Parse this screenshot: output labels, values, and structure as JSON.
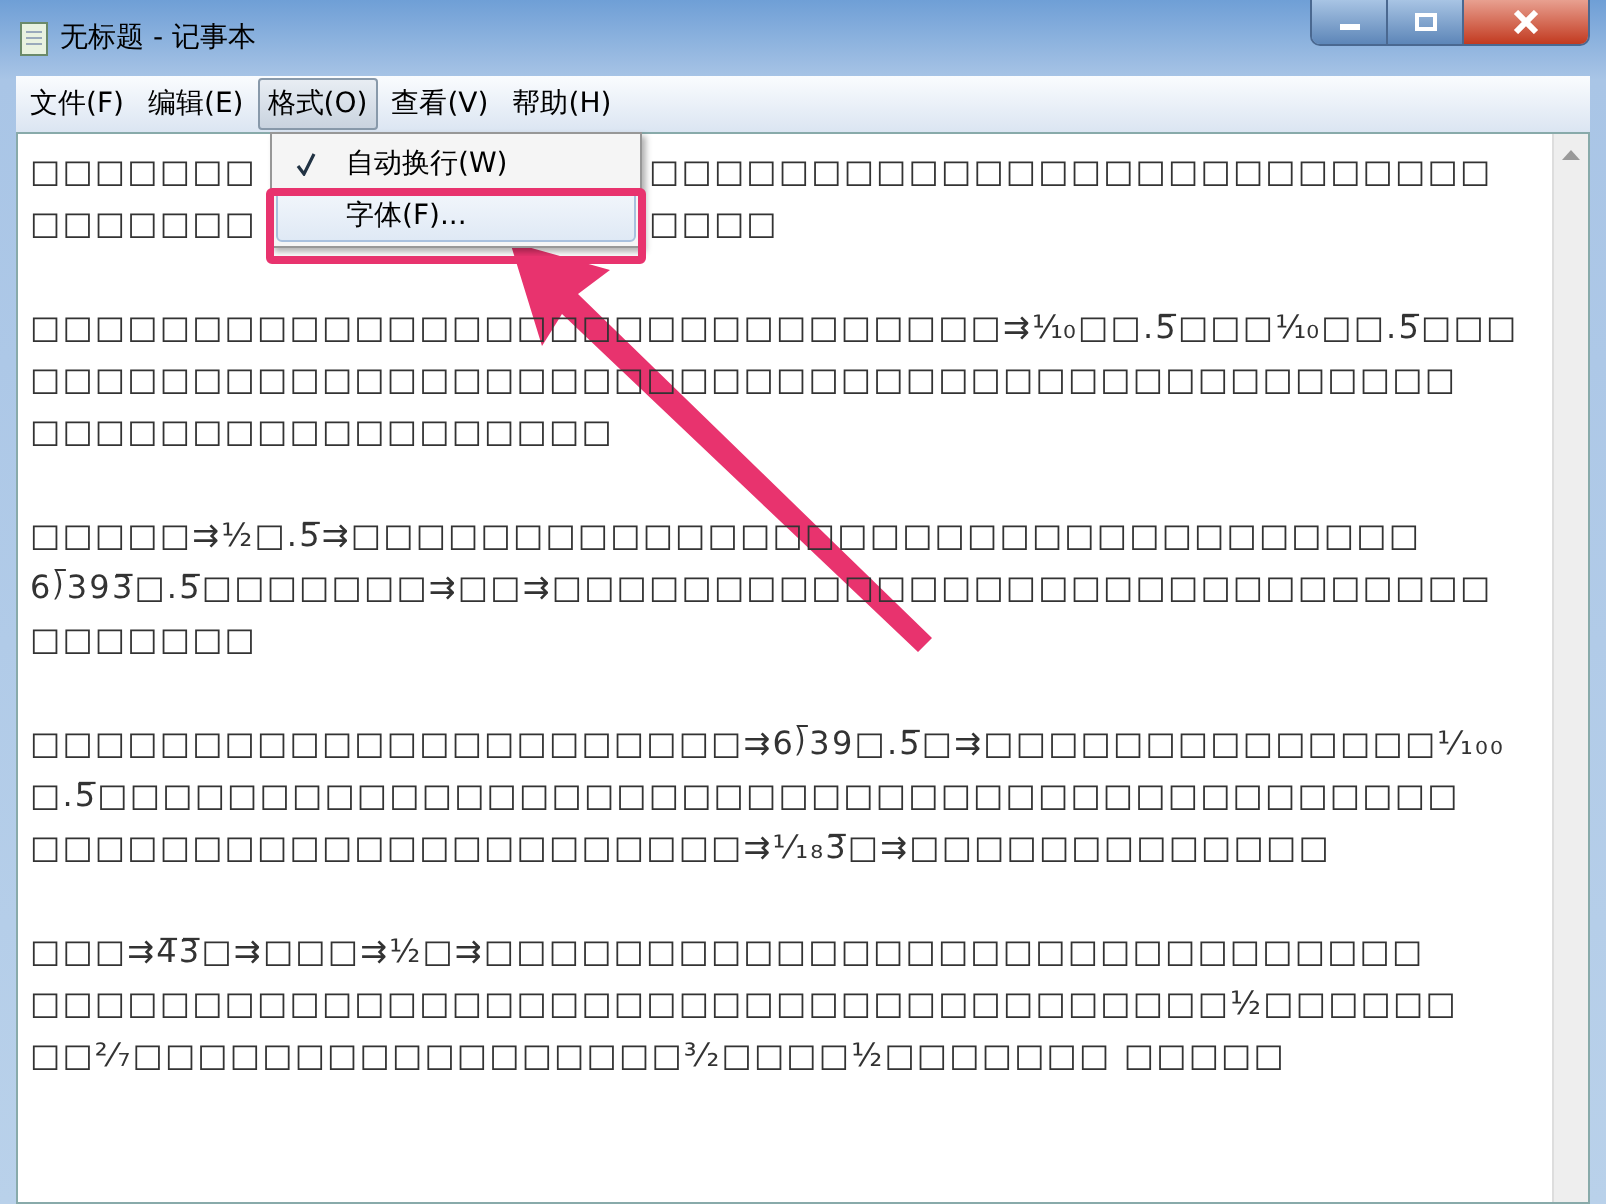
{
  "window": {
    "title": "无标题 - 记事本"
  },
  "menu_bar": [
    {
      "label": "文件(F)",
      "selected": false
    },
    {
      "label": "编辑(E)",
      "selected": false
    },
    {
      "label": "格式(O)",
      "selected": true
    },
    {
      "label": "查看(V)",
      "selected": false
    },
    {
      "label": "帮助(H)",
      "selected": false
    }
  ],
  "dropdown": [
    {
      "label": "自动换行(W)",
      "checked": true,
      "highlighted": false
    },
    {
      "label": "字体(F)...",
      "checked": false,
      "highlighted": true
    }
  ],
  "document": {
    "paragraphs": [
      [
        [
          "□□□□□□□",
          "□□□□□□□□□□□□□□□□□□□□□□□□□□"
        ],
        [
          "□□□□□□□",
          "□□□□"
        ]
      ],
      [
        [
          "□□□□□□□□□□□□□□□□□□□□□□□□□□□□□□⇉⅒□□.5̅□□□⅒□□.5̅□□□"
        ],
        [
          "□□□□□□□□□□□□□□□□□□□□□□□□□□□□□□□□□□□□□□□□□□□□"
        ],
        [
          "□□□□□□□□□□□□□□□□□□"
        ]
      ],
      [
        [
          "□□□□□⇉½□.5̅⇉□□□□□□□□□□□□□□□□□□□□□□□□□□□□□□□□□"
        ],
        [
          "6⟌393̅□.5̅□□□□□□□⇉□□⇉□□□□□□□□□□□□□□□□□□□□□□□□□□□□□"
        ],
        [
          "□□□□□□□"
        ]
      ],
      [
        [
          "□□□□□□□□□□□□□□□□□□□□□□⇉6⟌39□.5̅□⇉□□□□□□□□□□□□□□¹⁄₁₀₀"
        ],
        [
          "□.5̅□□□□□□□□□□□□□□□□□□□□□□□□□□□□□□□□□□□□□□□□□□"
        ],
        [
          "□□□□□□□□□□□□□□□□□□□□□□⇉¹⁄₁₈3̅□⇉□□□□□□□□□□□□□"
        ]
      ],
      [
        [
          "□□□⇉4̅3̅□⇉□□□⇉½□⇉□□□□□□□□□□□□□□□□□□□□□□□□□□□□□"
        ],
        [
          "□□□□□□□□□□□□□□□□□□□□□□□□□□□□□□□□□□□□□½□□□□□□"
        ],
        [
          "□□²⁄₇□□□□□□□□□□□□□□□□□³⁄₂□□□□½□□□□□□□ □□□□□"
        ]
      ]
    ]
  }
}
